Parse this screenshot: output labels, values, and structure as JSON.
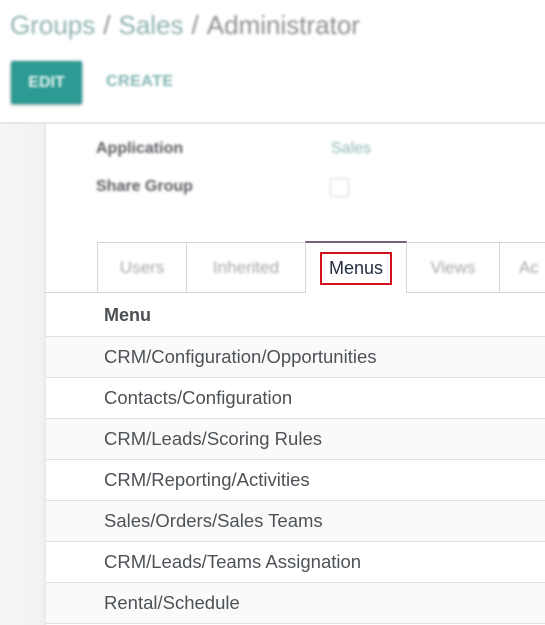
{
  "breadcrumb": {
    "items": [
      "Groups",
      "Sales",
      "Administrator"
    ],
    "separator": "/"
  },
  "toolbar": {
    "edit_label": "EDIT",
    "create_label": "CREATE"
  },
  "form": {
    "application_label": "Application",
    "application_value": "Sales",
    "share_group_label": "Share Group",
    "share_group_checked": false
  },
  "tabs": [
    {
      "label": "Users",
      "active": false
    },
    {
      "label": "Inherited",
      "active": false
    },
    {
      "label": "Menus",
      "active": true
    },
    {
      "label": "Views",
      "active": false
    },
    {
      "label": "Ac",
      "active": false
    }
  ],
  "menus_list": {
    "column_header": "Menu",
    "rows": [
      "CRM/Configuration/Opportunities",
      "Contacts/Configuration",
      "CRM/Leads/Scoring Rules",
      "CRM/Reporting/Activities",
      "Sales/Orders/Sales Teams",
      "CRM/Leads/Teams Assignation",
      "Rental/Schedule"
    ]
  },
  "colors": {
    "primary": "#2d9a93",
    "active_tab_accent": "#7c5f7d",
    "highlight_box": "#d0101b"
  }
}
